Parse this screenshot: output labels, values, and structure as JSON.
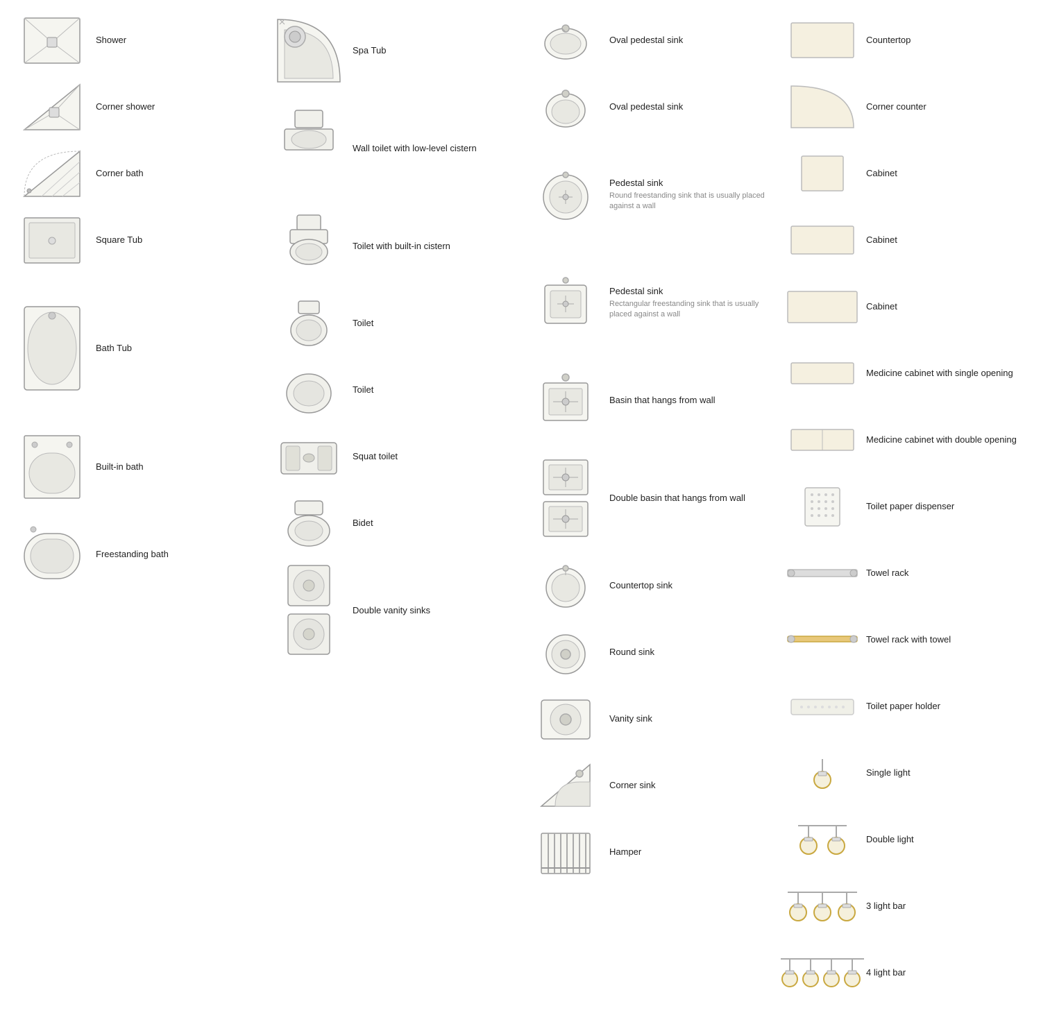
{
  "items": {
    "col1": [
      {
        "id": "shower",
        "label": "Shower",
        "sub": ""
      },
      {
        "id": "corner-shower",
        "label": "Corner shower",
        "sub": ""
      },
      {
        "id": "corner-bath",
        "label": "Corner bath",
        "sub": ""
      },
      {
        "id": "square-tub",
        "label": "Square Tub",
        "sub": ""
      },
      {
        "id": "bath-tub",
        "label": "Bath Tub",
        "sub": ""
      },
      {
        "id": "built-in-bath",
        "label": "Built-in bath",
        "sub": ""
      },
      {
        "id": "freestanding-bath",
        "label": "Freestanding bath",
        "sub": ""
      }
    ],
    "col2": [
      {
        "id": "spa-tub",
        "label": "Spa Tub",
        "sub": ""
      },
      {
        "id": "wall-toilet-cistern",
        "label": "Wall toilet with low-level cistern",
        "sub": ""
      },
      {
        "id": "toilet-built-cistern",
        "label": "Toilet with built-in cistern",
        "sub": ""
      },
      {
        "id": "toilet1",
        "label": "Toilet",
        "sub": ""
      },
      {
        "id": "toilet2",
        "label": "Toilet",
        "sub": ""
      },
      {
        "id": "squat-toilet",
        "label": "Squat toilet",
        "sub": ""
      },
      {
        "id": "bidet",
        "label": "Bidet",
        "sub": ""
      },
      {
        "id": "double-vanity-sinks",
        "label": "Double vanity sinks",
        "sub": ""
      }
    ],
    "col3": [
      {
        "id": "oval-pedestal-sink1",
        "label": "Oval pedestal sink",
        "sub": ""
      },
      {
        "id": "oval-pedestal-sink2",
        "label": "Oval pedestal sink",
        "sub": ""
      },
      {
        "id": "pedestal-sink-round",
        "label": "Pedestal sink",
        "sub": "Round freestanding sink that is usually placed against a wall"
      },
      {
        "id": "pedestal-sink-rect",
        "label": "Pedestal sink",
        "sub": "Rectangular freestanding sink that is usually placed against a wall"
      },
      {
        "id": "basin-wall",
        "label": "Basin that hangs from wall",
        "sub": ""
      },
      {
        "id": "double-basin-wall",
        "label": "Double basin that hangs from wall",
        "sub": ""
      },
      {
        "id": "countertop-sink",
        "label": "Countertop sink",
        "sub": ""
      },
      {
        "id": "round-sink",
        "label": "Round sink",
        "sub": ""
      },
      {
        "id": "vanity-sink",
        "label": "Vanity sink",
        "sub": ""
      },
      {
        "id": "corner-sink",
        "label": "Corner sink",
        "sub": ""
      },
      {
        "id": "hamper",
        "label": "Hamper",
        "sub": ""
      }
    ],
    "col4": [
      {
        "id": "countertop",
        "label": "Countertop",
        "sub": ""
      },
      {
        "id": "corner-counter",
        "label": "Corner counter",
        "sub": ""
      },
      {
        "id": "cabinet1",
        "label": "Cabinet",
        "sub": ""
      },
      {
        "id": "cabinet2",
        "label": "Cabinet",
        "sub": ""
      },
      {
        "id": "cabinet3",
        "label": "Cabinet",
        "sub": ""
      },
      {
        "id": "medicine-cabinet-single",
        "label": "Medicine cabinet with single opening",
        "sub": ""
      },
      {
        "id": "medicine-cabinet-double",
        "label": "Medicine cabinet with double opening",
        "sub": ""
      },
      {
        "id": "toilet-paper-dispenser",
        "label": "Toilet paper dispenser",
        "sub": ""
      },
      {
        "id": "towel-rack",
        "label": "Towel rack",
        "sub": ""
      },
      {
        "id": "towel-rack-towel",
        "label": "Towel rack with towel",
        "sub": ""
      },
      {
        "id": "toilet-paper-holder",
        "label": "Toilet paper holder",
        "sub": ""
      },
      {
        "id": "single-light",
        "label": "Single light",
        "sub": ""
      },
      {
        "id": "double-light",
        "label": "Double light",
        "sub": ""
      },
      {
        "id": "3-light-bar",
        "label": "3 light bar",
        "sub": ""
      },
      {
        "id": "4-light-bar",
        "label": "4 light bar",
        "sub": ""
      }
    ]
  }
}
